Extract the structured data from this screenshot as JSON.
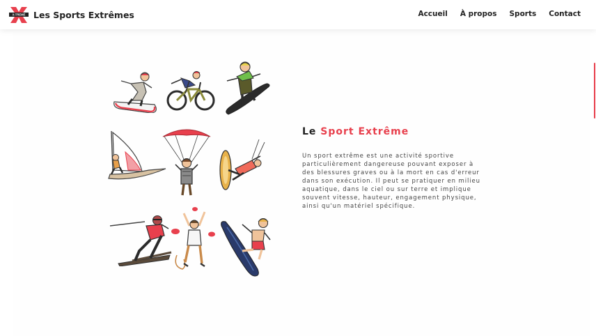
{
  "header": {
    "logo_text": "X-TREME",
    "brand_name": "Les Sports Extrêmes",
    "nav": [
      "Accueil",
      "À propos",
      "Sports",
      "Contact"
    ]
  },
  "hero": {
    "title_prefix": "Le",
    "title_highlight": "Sport Extrême",
    "paragraph": "Un sport extrême est une activité sportive particulièrement dangereuse pouvant exposer à des blessures graves ou à la mort en cas d'erreur dans son exécution. Il peut se pratiquer en milieu aquatique, dans le ciel ou sur terre et implique souvent vitesse, hauteur, engagement physique, ainsi qu'un matériel spécifique."
  },
  "illustrations": [
    "snowboard",
    "bmx",
    "skateboard",
    "windsurf",
    "parachute",
    "kitesurf",
    "ski",
    "climbing",
    "wakeboard"
  ],
  "colors": {
    "accent": "#e8404d",
    "text": "#222222"
  }
}
